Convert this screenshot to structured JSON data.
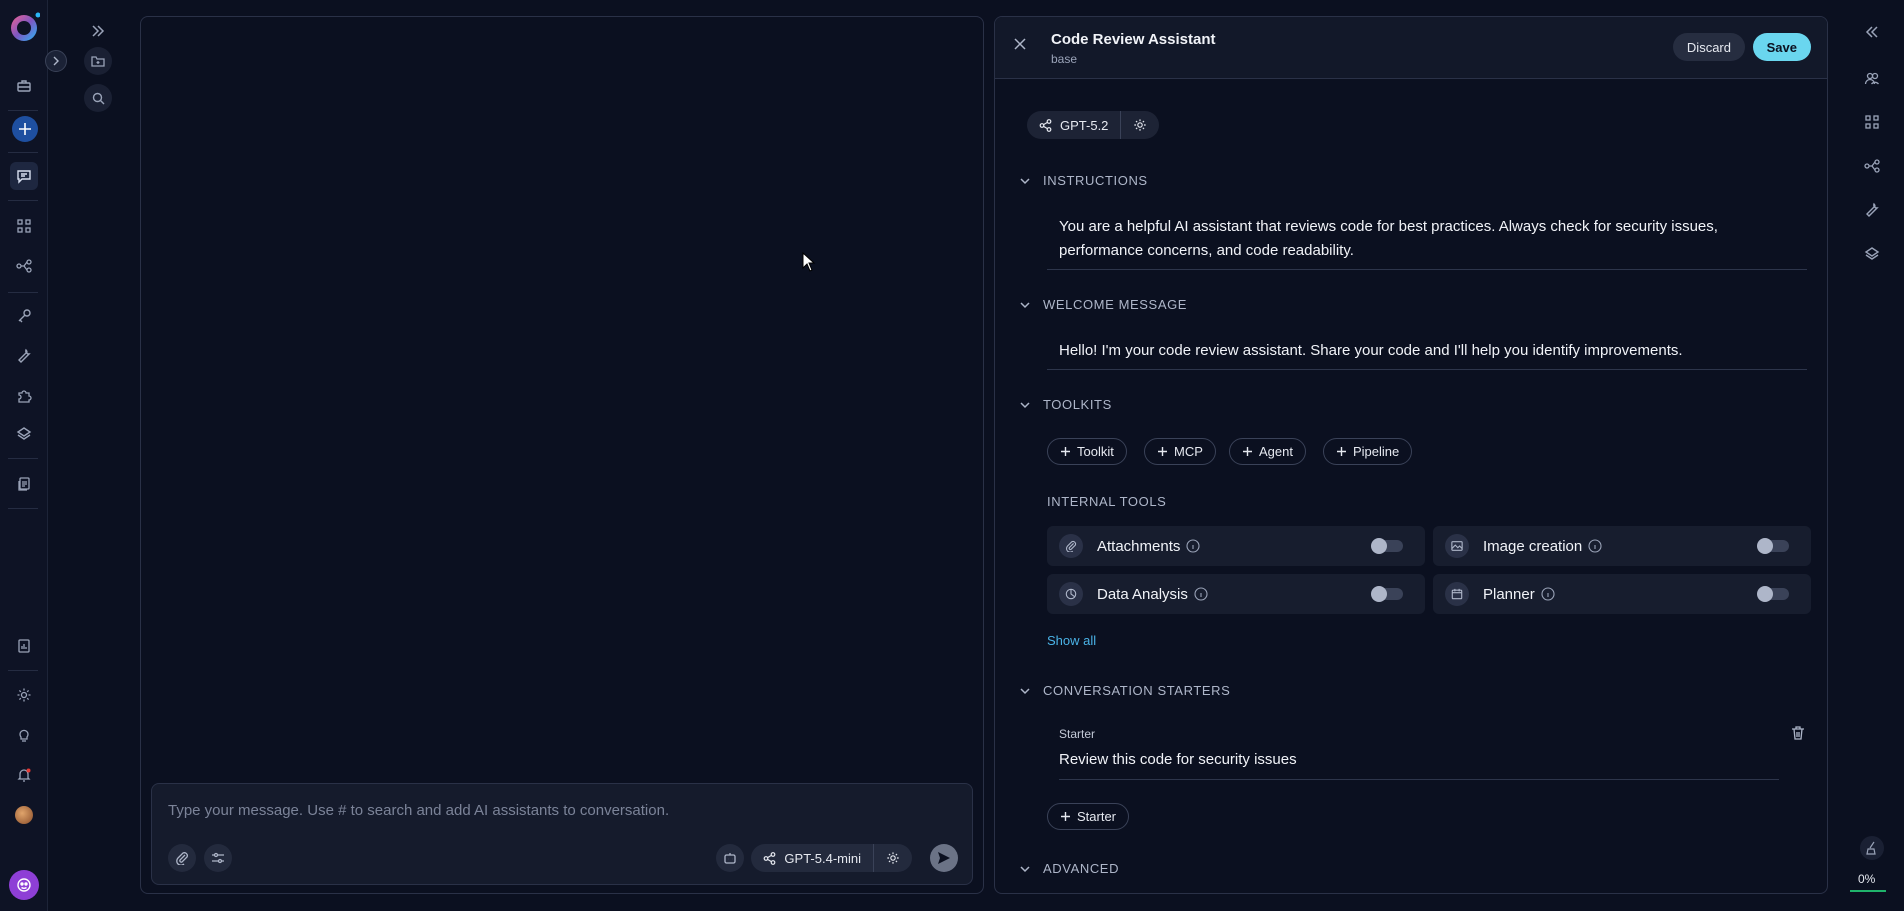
{
  "sidebar": {
    "icons": [
      "logo-icon",
      "briefcase-icon",
      "plus-icon",
      "chat-icon",
      "grid-icon",
      "flow-icon",
      "key-icon",
      "wrench-icon",
      "puzzle-icon",
      "layers-icon",
      "docs-icon",
      "report-icon",
      "settings-icon",
      "bulb-icon",
      "bell-icon",
      "avatar-icon",
      "bot-icon"
    ]
  },
  "chat": {
    "placeholder": "Type your message. Use # to search and add AI assistants to conversation.",
    "model": "GPT-5.4-mini"
  },
  "config": {
    "title": "Code Review Assistant",
    "subtitle": "base",
    "discard": "Discard",
    "save": "Save",
    "model": "GPT-5.2",
    "sections": {
      "instructions": "INSTRUCTIONS",
      "welcome": "WELCOME MESSAGE",
      "toolkits": "TOOLKITS",
      "starters": "CONVERSATION STARTERS",
      "advanced": "ADVANCED"
    },
    "instructions_text": "You are a helpful AI assistant that reviews code for best practices. Always check for security issues, performance concerns, and code readability.",
    "welcome_text": "Hello! I'm your code review assistant. Share your code and I'll help you identify improvements.",
    "toolkit_buttons": [
      "Toolkit",
      "MCP",
      "Agent",
      "Pipeline"
    ],
    "internal_tools_label": "INTERNAL TOOLS",
    "tools": [
      "Attachments",
      "Image creation",
      "Data Analysis",
      "Planner"
    ],
    "show_all": "Show all",
    "starter_label": "Starter",
    "starter_value": "Review this code for security issues",
    "add_starter": "Starter"
  },
  "context_usage": "0%",
  "colors": {
    "accent": "#6ad6ef",
    "link": "#4ab2e6",
    "bg": "#0b1020"
  }
}
